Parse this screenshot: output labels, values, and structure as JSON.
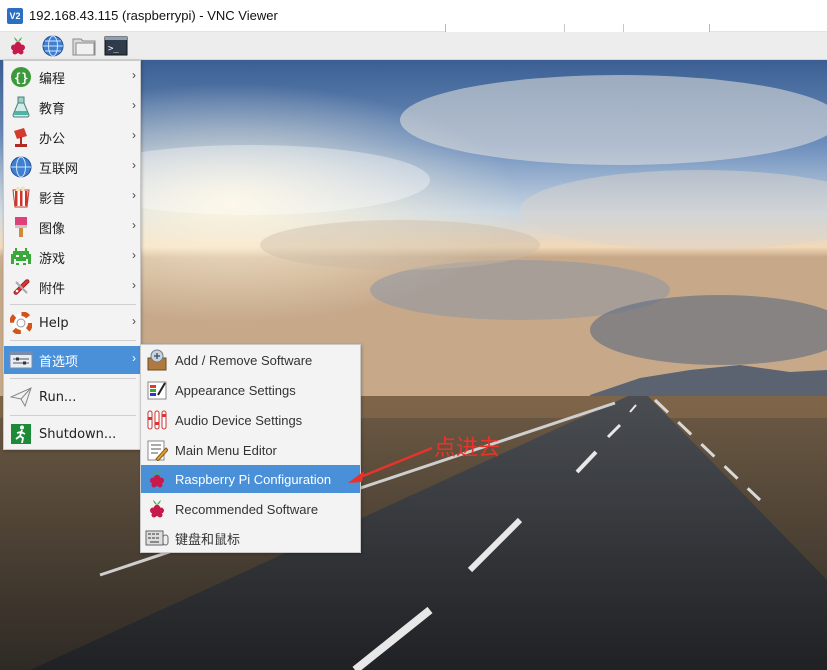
{
  "window": {
    "logo": "V2",
    "title": "192.168.43.115 (raspberrypi) - VNC Viewer"
  },
  "panel": {
    "buttons": [
      {
        "icon": "raspberry-menu-icon"
      },
      {
        "icon": "globe-icon"
      },
      {
        "icon": "folder-icon"
      },
      {
        "icon": "terminal-icon"
      }
    ]
  },
  "menu": {
    "items": [
      {
        "label": "编程",
        "icon": "programming-icon",
        "has_submenu": true
      },
      {
        "label": "教育",
        "icon": "education-icon",
        "has_submenu": true
      },
      {
        "label": "办公",
        "icon": "office-icon",
        "has_submenu": true
      },
      {
        "label": "互联网",
        "icon": "internet-icon",
        "has_submenu": true
      },
      {
        "label": "影音",
        "icon": "sound-video-icon",
        "has_submenu": true
      },
      {
        "label": "图像",
        "icon": "graphics-icon",
        "has_submenu": true
      },
      {
        "label": "游戏",
        "icon": "games-icon",
        "has_submenu": true
      },
      {
        "label": "附件",
        "icon": "accessories-icon",
        "has_submenu": true
      },
      {
        "label": "Help",
        "icon": "help-icon",
        "has_submenu": true
      },
      {
        "label": "首选项",
        "icon": "preferences-icon",
        "has_submenu": true,
        "active": true
      },
      {
        "label": "Run...",
        "icon": "run-icon",
        "has_submenu": false
      },
      {
        "label": "Shutdown...",
        "icon": "shutdown-icon",
        "has_submenu": false
      }
    ],
    "arrow": "›"
  },
  "submenu": {
    "items": [
      {
        "label": "Add / Remove Software",
        "icon": "package-icon"
      },
      {
        "label": "Appearance Settings",
        "icon": "appearance-icon"
      },
      {
        "label": "Audio Device Settings",
        "icon": "audio-settings-icon"
      },
      {
        "label": "Main Menu Editor",
        "icon": "menu-editor-icon"
      },
      {
        "label": "Raspberry Pi Configuration",
        "icon": "raspberry-config-icon",
        "active": true
      },
      {
        "label": "Recommended Software",
        "icon": "raspberry-icon"
      },
      {
        "label": "键盘和鼠标",
        "icon": "keyboard-mouse-icon"
      }
    ]
  },
  "annotation": {
    "text": "点进去",
    "color": "#e8332a"
  },
  "colors": {
    "highlight": "#4a90d9",
    "menu_bg": "#f3f3f3"
  }
}
